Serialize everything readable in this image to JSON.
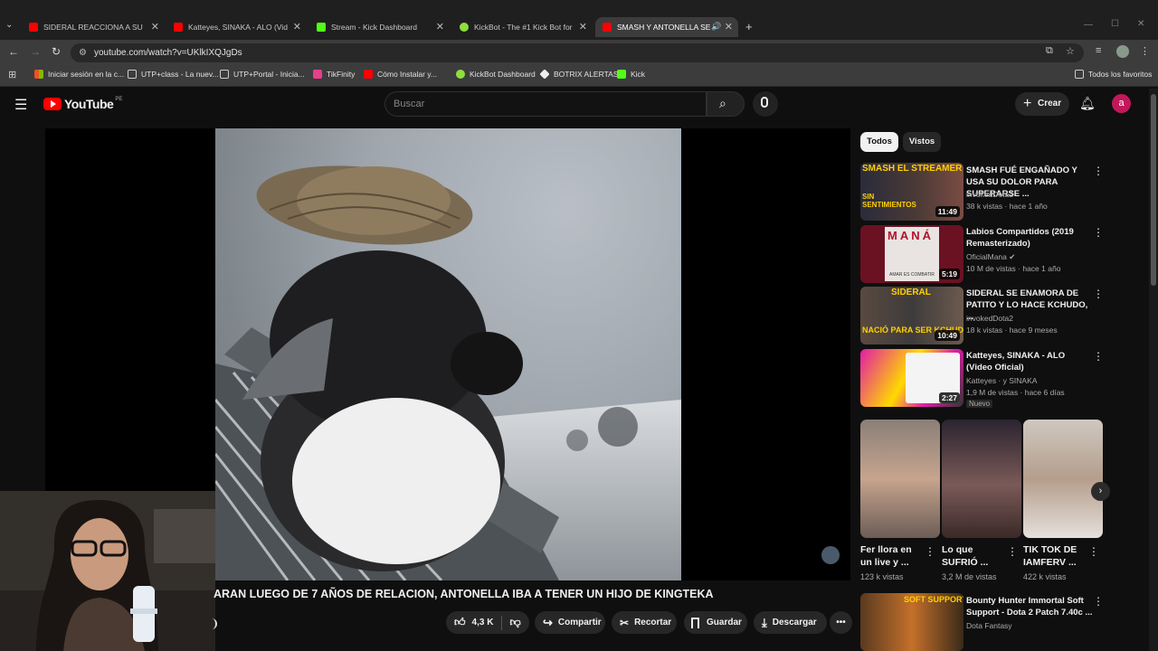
{
  "browser": {
    "tabs": [
      {
        "title": "SIDERAL REACCIONA A SU REP",
        "favicon": "youtube-icon",
        "active": false
      },
      {
        "title": "Katteyes, SINAKA - ALO (Video",
        "favicon": "youtube-icon",
        "active": false
      },
      {
        "title": "Stream - Kick Dashboard",
        "favicon": "kick-icon",
        "active": false
      },
      {
        "title": "KickBot - The #1 Kick Bot for C",
        "favicon": "kickbot-icon",
        "active": false
      },
      {
        "title": "SMASH Y ANTONELLA SE S",
        "favicon": "youtube-icon",
        "active": true
      }
    ],
    "url": "youtube.com/watch?v=UKlkIXQJgDs",
    "bookmarks": [
      {
        "label": "Iniciar sesión en la c...",
        "icon": "windows-icon"
      },
      {
        "label": "UTP+class - La nuev...",
        "icon": "page-icon"
      },
      {
        "label": "UTP+Portal - Inicia...",
        "icon": "page-icon"
      },
      {
        "label": "TikFinity",
        "icon": "tikfinity-icon"
      },
      {
        "label": "Cómo Instalar y...",
        "icon": "youtube-icon"
      },
      {
        "label": "KickBot Dashboard",
        "icon": "kickbot-icon"
      },
      {
        "label": "BOTRIX ALERTAS",
        "icon": "botrix-icon"
      },
      {
        "label": "Kick",
        "icon": "kick-icon"
      }
    ],
    "all_bookmarks": "Todos los favoritos"
  },
  "youtube": {
    "logo_text": "YouTube",
    "region": "PE",
    "search_placeholder": "Buscar",
    "create_label": "Crear",
    "avatar_letter": "a"
  },
  "video": {
    "title": "ARAN LUEGO DE 7 AÑOS DE RELACION, ANTONELLA IBA A TENER UN HIJO DE KINGTEKA",
    "likes": "4,3 K",
    "actions": {
      "share": "Compartir",
      "clip": "Recortar",
      "save": "Guardar",
      "download": "Descargar"
    }
  },
  "sidebar": {
    "chips": [
      "Todos",
      "Vistos"
    ],
    "recommendations": [
      {
        "title": "SMASH FUÉ ENGAÑADO Y USA SU DOLOR PARA SUPERARSE ...",
        "channel": "invokedDota2",
        "meta": "38 k vistas · hace 1 año",
        "duration": "11:49",
        "thumb_text": "SMASH EL STREAMER",
        "thumb_text2": "SIN SENTIMIENTOS"
      },
      {
        "title": "Labios Compartidos (2019 Remasterizado)",
        "channel": "OficialMana",
        "meta": "10 M de vistas · hace 1 año",
        "duration": "5:19",
        "thumb_text": "MANÁ",
        "thumb_text2": "AMAR ES COMBATIR"
      },
      {
        "title": "SIDERAL SE ENAMORA DE PATITO Y LO HACE KCHUDO, ...",
        "channel": "invokedDota2",
        "meta": "18 k vistas · hace 9 meses",
        "duration": "10:49",
        "thumb_text": "SIDERAL",
        "thumb_text2": "NACIÓ PARA SER KCHUDO"
      },
      {
        "title": "Katteyes, SINAKA - ALO (Video Oficial)",
        "channel": "Katteyes · y SINAKA",
        "meta": "1,9 M de vistas · hace 6 días",
        "duration": "2:27",
        "badge": "Nuevo"
      }
    ],
    "shorts": [
      {
        "title": "Fer llora en un live y ...",
        "views": "123 k vistas"
      },
      {
        "title": "Lo que SUFRIÓ ...",
        "views": "3,2 M de vistas"
      },
      {
        "title": "TIK TOK DE IAMFERV ...",
        "views": "422 k vistas"
      }
    ],
    "bottom_rec": {
      "title": "Bounty Hunter Immortal Soft Support - Dota 2 Patch 7.40c ...",
      "channel": "Dota Fantasy",
      "thumb_text": "SOFT SUPPORT"
    }
  }
}
